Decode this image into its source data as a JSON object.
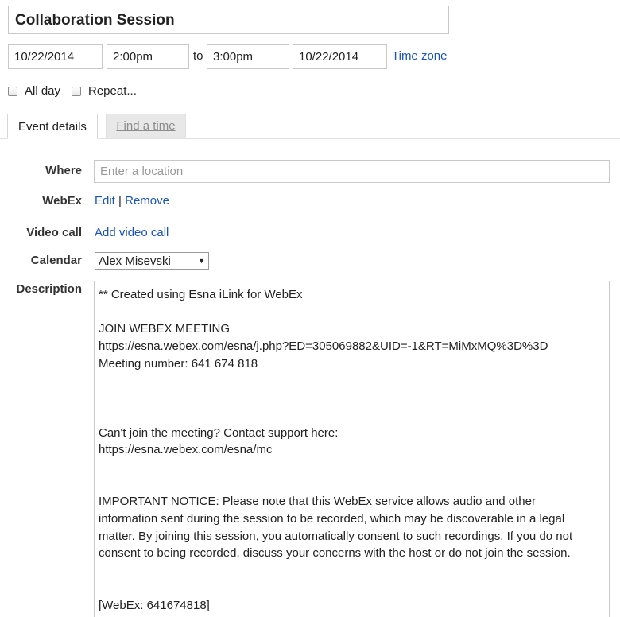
{
  "event": {
    "title": "Collaboration Session",
    "start_date": "10/22/2014",
    "start_time": "2:00pm",
    "to_label": "to",
    "end_time": "3:00pm",
    "end_date": "10/22/2014",
    "timezone_link": "Time zone",
    "all_day_label": "All day",
    "repeat_label": "Repeat..."
  },
  "tabs": [
    {
      "label": "Event details",
      "active": true
    },
    {
      "label": "Find a time",
      "active": false
    }
  ],
  "details": {
    "where_label": "Where",
    "where_placeholder": "Enter a location",
    "webex_label": "WebEx",
    "webex_edit": "Edit",
    "webex_sep": "|",
    "webex_remove": "Remove",
    "video_label": "Video call",
    "video_link": "Add video call",
    "calendar_label": "Calendar",
    "calendar_value": "Alex Misevski",
    "description_label": "Description",
    "description_lines": [
      "** Created using Esna iLink for WebEx",
      "",
      "JOIN WEBEX MEETING",
      "https://esna.webex.com/esna/j.php?ED=305069882&UID=-1&RT=MiMxMQ%3D%3D",
      "Meeting number: 641 674 818",
      "",
      "",
      "",
      "Can't join the meeting? Contact support here:",
      "https://esna.webex.com/esna/mc",
      "",
      "",
      "IMPORTANT NOTICE: Please note that this WebEx service allows audio and other",
      "information sent during the session to be recorded, which may be discoverable in a legal",
      "matter. By joining this session, you automatically consent to such recordings. If you do not",
      "consent to being recorded, discuss your concerns with the host or do not join the session.",
      "",
      "",
      "[WebEx: 641674818]"
    ]
  }
}
